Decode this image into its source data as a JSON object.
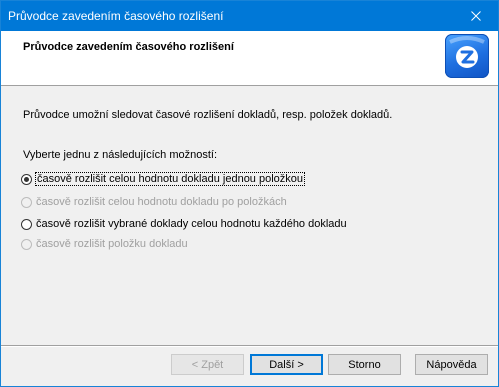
{
  "window": {
    "title": "Průvodce zavedením časového rozlišení",
    "close_glyph": "✕"
  },
  "header": {
    "title": "Průvodce zavedením časového rozlišení",
    "logo_icon": "z-logo-icon"
  },
  "body": {
    "intro": "Průvodce umožní sledovat časové rozlišení dokladů, resp. položek dokladů.",
    "choose_label": "Vyberte jednu z následujících možností:",
    "options": [
      {
        "label": "časově rozlišit celou hodnotu dokladu jednou položkou",
        "checked": true,
        "enabled": true
      },
      {
        "label": "časově rozlišit celou hodnotu dokladu po položkách",
        "checked": false,
        "enabled": false
      },
      {
        "label": "časově rozlišit vybrané doklady celou hodnotu každého dokladu",
        "checked": false,
        "enabled": true
      },
      {
        "label": "časově rozlišit položku dokladu",
        "checked": false,
        "enabled": false
      }
    ]
  },
  "buttons": {
    "back": "< Zpět",
    "next": "Další >",
    "cancel": "Storno",
    "help": "Nápověda"
  },
  "colors": {
    "titlebar": "#0078d7",
    "accent": "#0078d7",
    "logo": "#1e6fe0"
  }
}
